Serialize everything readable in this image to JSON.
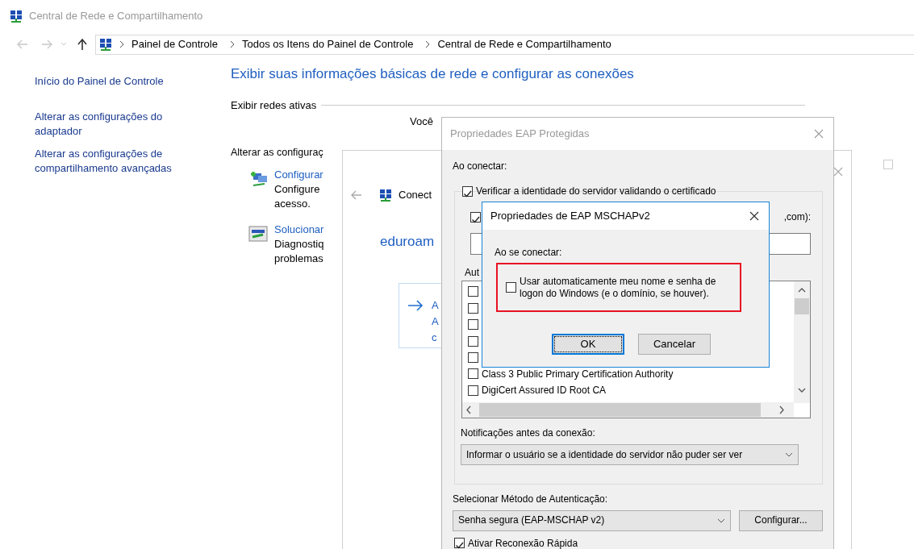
{
  "main_window": {
    "title": "Central de Rede e Compartilhamento",
    "navigation": {
      "back_disabled": true,
      "forward_disabled": true,
      "up_disabled": false
    },
    "breadcrumbs": [
      "Painel de Controle",
      "Todos os Itens do Painel de Controle",
      "Central de Rede e Compartilhamento"
    ],
    "sidebar_links": [
      "Início do Painel de Controle",
      "Alterar as configurações do adaptador",
      "Alterar as configurações de compartilhamento avançadas"
    ],
    "heading": "Exibir suas informações básicas de rede e configurar as conexões",
    "active_networks_label": "Exibir redes ativas",
    "active_networks_text": "Você",
    "change_settings_label": "Alterar as configuraç",
    "tasks": [
      {
        "kind": "setup",
        "title": "Configurar",
        "description_lines": [
          "Configure",
          "acesso."
        ]
      },
      {
        "kind": "troubleshoot",
        "title": "Solucionar",
        "description_lines": [
          "Diagnostiq",
          "problemas"
        ]
      }
    ]
  },
  "connection_window": {
    "title": "Conect",
    "network_name": "eduroam",
    "option_lines": [
      "A",
      "A",
      "c"
    ]
  },
  "eap_window": {
    "title": "Propriedades EAP Protegidas",
    "on_connect_label": "Ao conectar:",
    "verify_server": {
      "label": "Verificar a identidade do servidor validando o certificado",
      "checked": true
    },
    "connect_to_servers": {
      "label": ",com):",
      "checked": true
    },
    "authorities_label": "Aut",
    "certificates": [
      {
        "checked": false
      },
      {
        "checked": false
      },
      {
        "checked": false
      },
      {
        "checked": false
      },
      {
        "checked": false
      },
      {
        "label": "Class 3 Public Primary Certification Authority",
        "checked": false
      },
      {
        "label": "DigiCert Assured ID Root CA",
        "checked": false
      }
    ],
    "notifications_label": "Notificações antes da conexão:",
    "notifications_value": "Informar o usuário se a identidade do servidor não puder ser ver",
    "auth_method_label": "Selecionar Método de Autenticação:",
    "auth_method_value": "Senha segura (EAP-MSCHAP v2)",
    "configure_button": "Configurar...",
    "fast_reconnect": {
      "label": "Ativar Reconexão Rápida",
      "checked": true
    }
  },
  "mschap_dialog": {
    "title": "Propriedades de EAP MSCHAPv2",
    "on_connect_label": "Ao se conectar:",
    "use_windows_logon": {
      "label": "Usar automaticamente meu nome e senha de logon do Windows (e o domínio, se houver).",
      "checked": false,
      "highlighted": true
    },
    "buttons": [
      {
        "label": "OK",
        "focused": true
      },
      {
        "label": "Cancelar",
        "focused": false
      }
    ]
  }
}
